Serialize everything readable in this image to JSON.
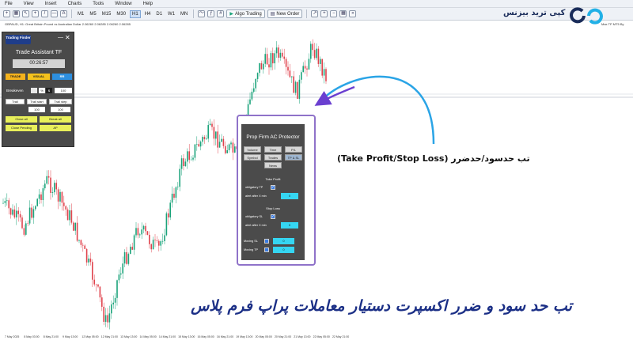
{
  "menu": [
    "File",
    "View",
    "Insert",
    "Charts",
    "Tools",
    "Window",
    "Help"
  ],
  "toolbar": {
    "timeframes": [
      "M1",
      "M5",
      "M15",
      "M30",
      "H1",
      "H4",
      "D1",
      "W1",
      "MN"
    ],
    "active_timeframe": "H1",
    "algo_trading": "Algo Trading",
    "new_order": "New Order"
  },
  "chart": {
    "info": "GBPAUD, H1: Great Britain Pound vs Australian Dollar 2.06260 2.06285 2.06260 2.06285",
    "right_label": "Max TP MT5 By",
    "time_axis": [
      "7 May 2025",
      "8 May 03:00",
      "8 May 21:00",
      "9 May 13:00",
      "12 May 05:00",
      "12 May 21:00",
      "13 May 13:00",
      "14 May 05:00",
      "14 May 21:00",
      "15 May 13:00",
      "16 May 05:00",
      "16 May 21:00",
      "19 May 13:00",
      "20 May 05:00",
      "20 May 21:00",
      "21 May 13:00",
      "22 May 05:00",
      "22 May 21:00"
    ]
  },
  "trade_assistant": {
    "logo": "Trading Finder",
    "title": "Trade Assistant TF",
    "timer": "00:26:57",
    "tabs": [
      "TRADE",
      "VISUAL",
      "RR"
    ],
    "breakeven_label": "Breakeven",
    "pct_label": "%",
    "dollar_label": "$",
    "breakeven_value": "100",
    "trail": "Trail",
    "trail_start": "Trail start",
    "trail_step": "Trail step",
    "trail_start_value": "100",
    "trail_step_value": "100",
    "close_all": "Close all",
    "break_all": "Break all",
    "close_pending": "Close Pending",
    "ap": "AP"
  },
  "prop_firm": {
    "title": "Prop Firm AC Protector",
    "tabs": [
      "Volume",
      "Time",
      "P/L",
      "Symbol",
      "Trades",
      "TP & SL",
      "News"
    ],
    "active_tab": "TP & SL",
    "take_profit_header": "Take Profit",
    "obligatory_tp": "obligatory TP",
    "alert_after_tp": "alert after X min",
    "alert_tp_value": "0",
    "stop_loss_header": "Stop Loss",
    "obligatory_sl": "obligatory SL",
    "alert_after_sl": "alert after X min",
    "alert_sl_value": "0",
    "moving_sl": "Moving SL",
    "moving_sl_value": "0",
    "moving_tp": "Moving TP",
    "moving_tp_value": "0"
  },
  "annotation": "تب حدسود/حدضرر (Take Profit/Stop Loss)",
  "brand": "کپی ترید بیزنس",
  "caption": "تب حد سود و ضرر اکسپرت دستیار معاملات پراپ فرم پلاس",
  "colors": {
    "bull": "#1aa37a",
    "bear": "#e0434d",
    "panel": "#4a4a4a",
    "frame": "#8f72c9",
    "caption": "#1b2f86",
    "accent_cyan": "#35d6f2"
  }
}
